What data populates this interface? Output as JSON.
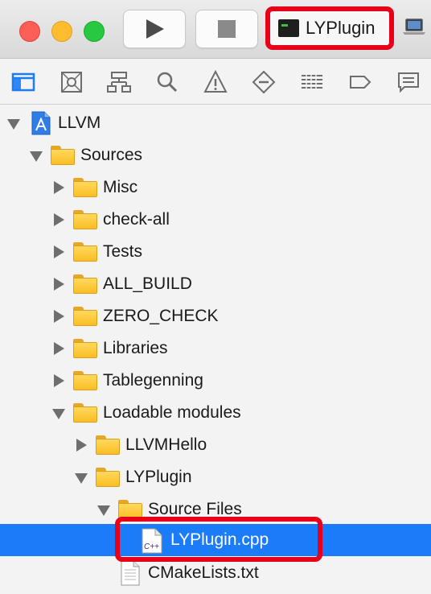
{
  "toolbar": {
    "scheme_name": "LYPlugin",
    "scheme_highlight_color": "#e8001b",
    "icons": [
      "close-traffic-light",
      "minimize-traffic-light",
      "zoom-traffic-light",
      "play-icon",
      "stop-icon",
      "terminal-icon",
      "laptop-icon"
    ]
  },
  "navigator_icons": [
    "folder-icon",
    "source-control-icon",
    "hierarchy-icon",
    "search-icon",
    "warning-icon",
    "test-icon",
    "debug-icon",
    "breakpoint-icon",
    "report-icon"
  ],
  "tree": {
    "selection_color": "#1a7cf9",
    "items": [
      {
        "label": "LLVM",
        "level": 0,
        "expanded": true,
        "icon": "project-icon"
      },
      {
        "label": "Sources",
        "level": 1,
        "expanded": true,
        "icon": "folder-icon"
      },
      {
        "label": "Misc",
        "level": 2,
        "expanded": false,
        "icon": "folder-icon"
      },
      {
        "label": "check-all",
        "level": 2,
        "expanded": false,
        "icon": "folder-icon"
      },
      {
        "label": "Tests",
        "level": 2,
        "expanded": false,
        "icon": "folder-icon"
      },
      {
        "label": "ALL_BUILD",
        "level": 2,
        "expanded": false,
        "icon": "folder-icon"
      },
      {
        "label": "ZERO_CHECK",
        "level": 2,
        "expanded": false,
        "icon": "folder-icon"
      },
      {
        "label": "Libraries",
        "level": 2,
        "expanded": false,
        "icon": "folder-icon"
      },
      {
        "label": "Tablegenning",
        "level": 2,
        "expanded": false,
        "icon": "folder-icon"
      },
      {
        "label": "Loadable modules",
        "level": 2,
        "expanded": true,
        "icon": "folder-icon"
      },
      {
        "label": "LLVMHello",
        "level": 3,
        "expanded": false,
        "icon": "folder-icon"
      },
      {
        "label": "LYPlugin",
        "level": 3,
        "expanded": true,
        "icon": "folder-icon"
      },
      {
        "label": "Source Files",
        "level": 4,
        "expanded": true,
        "icon": "folder-icon"
      },
      {
        "label": "LYPlugin.cpp",
        "level": 5,
        "selected": true,
        "icon": "cpp-file-icon",
        "badge": "C++"
      },
      {
        "label": "CMakeLists.txt",
        "level": 5,
        "icon": "text-file-icon"
      }
    ]
  }
}
